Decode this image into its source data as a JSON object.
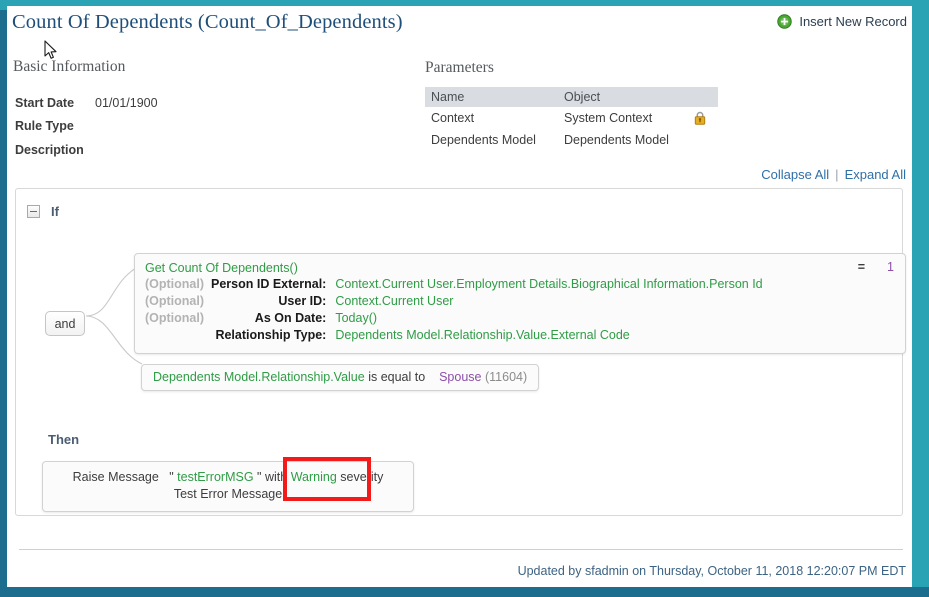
{
  "header": {
    "title": "Count Of Dependents (Count_Of_Dependents)",
    "insert_new_record": "Insert New Record",
    "plus_icon": "circle-plus-icon"
  },
  "basic_information": {
    "heading": "Basic Information",
    "fields": [
      {
        "label": "Start Date",
        "value": "01/01/1900"
      },
      {
        "label": "Rule Type",
        "value": ""
      },
      {
        "label": "Description",
        "value": ""
      }
    ]
  },
  "parameters": {
    "heading": "Parameters",
    "columns": [
      "Name",
      "Object"
    ],
    "rows": [
      {
        "name": "Context",
        "object": "System Context",
        "locked": true,
        "lock_icon": "padlock-icon"
      },
      {
        "name": "Dependents Model",
        "object": "Dependents Model",
        "locked": false,
        "lock_icon": ""
      }
    ]
  },
  "toolbar": {
    "collapse_all": "Collapse All",
    "expand_all": "Expand All",
    "separator": "|"
  },
  "rule": {
    "if_label": "If",
    "then_label": "Then",
    "connector_label": "and",
    "condition_1": {
      "function_name": "Get Count Of Dependents()",
      "args": [
        {
          "optional": "(Optional)",
          "label": "Person ID External:",
          "value": "Context.Current User.Employment Details.Biographical Information.Person Id"
        },
        {
          "optional": "(Optional)",
          "label": "User ID:",
          "value": "Context.Current User"
        },
        {
          "optional": "(Optional)",
          "label": "As On Date:",
          "value": "Today()"
        },
        {
          "optional": "",
          "label": "Relationship Type:",
          "value": "Dependents Model.Relationship.Value.External Code"
        }
      ],
      "operator": "=",
      "result_value": "1"
    },
    "condition_2": {
      "field": "Dependents Model.Relationship.Value",
      "operator": "is equal to",
      "value": "Spouse",
      "value_code": "(11604)"
    },
    "action": {
      "verb": "Raise Message",
      "quote_open": "\"",
      "message_key": "testErrorMSG",
      "quote_close": "\"",
      "with_word": "with",
      "severity": "Warning",
      "severity_word": "severity",
      "message_text": "Test Error Message"
    }
  },
  "footer": {
    "updated_text": "Updated by sfadmin on Thursday, October 11, 2018 12:20:07 PM EDT"
  },
  "colors": {
    "frame_teal": "#2aa3b5",
    "frame_dark": "#1c6d8e",
    "title_blue": "#1f4e79",
    "green_token": "#2f9c46",
    "purple_token": "#8d4fa8",
    "link_blue": "#2f6fa8",
    "annotation_red": "#f21a1a"
  }
}
